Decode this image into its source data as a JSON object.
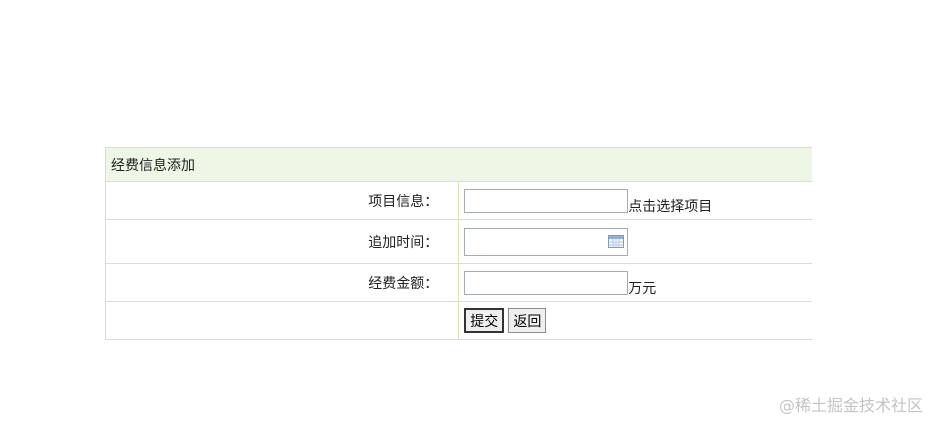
{
  "form": {
    "title": "经费信息添加",
    "fields": [
      {
        "label": "项目信息：",
        "value": "",
        "suffix": "点击选择项目"
      },
      {
        "label": "追加时间：",
        "value": "",
        "icon": "calendar-icon"
      },
      {
        "label": "经费金额：",
        "value": "",
        "suffix": "万元"
      }
    ],
    "buttons": {
      "submit": "提交",
      "back": "返回"
    }
  },
  "watermark": "@稀土掘金技术社区",
  "colors": {
    "border": "#d6e3bd",
    "header_bg": "#eef6e6",
    "watermark": "#c4c4c4"
  }
}
